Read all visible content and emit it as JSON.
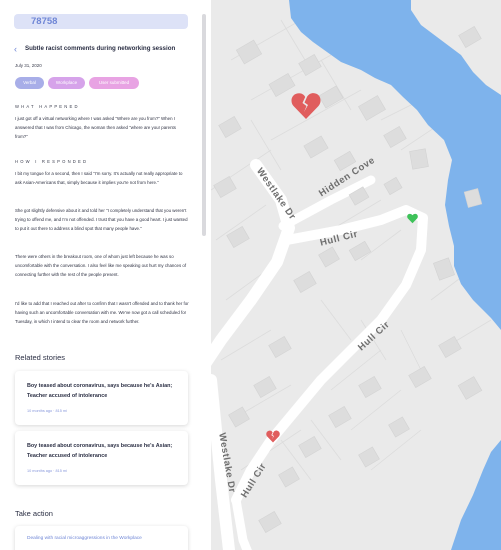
{
  "search": {
    "value": "78758"
  },
  "story": {
    "back_icon": "chevron-left-icon",
    "title": "Subtle racist comments during networking session",
    "date": "July 31, 2020",
    "tags": [
      "Verbal",
      "Workplace",
      "User submitted"
    ],
    "what_happened_label": "WHAT HAPPENED",
    "what_happened": "I just got off a virtual networking where I was asked \"Where are you from?\" When I answered that I was from Chicago, the woman then asked \"where are your parents from?\"",
    "how_responded_label": "HOW I RESPONDED",
    "responses": [
      "I bit my tongue for a second, then I said \"I'm sorry. It's actually not really appropriate to ask Asian-Americans that, simply because it implies you're not from here.\"",
      "She got slightly defensive about it and told her \"I completely understand that you weren't trying to offend me, and I'm not offended. I trust that you have a good heart. I just wanted to put it out there to address a blind spot that many people have.\"",
      "There were others in the breakout room, one of whom just left because he was so uncomfortable with the conversation. I also feel like me speaking out hurt my chances of connecting further with the rest of the people present.",
      "I'd like to add that I reached out after to confirm that I wasn't offended and to thank her for having such an uncomfortable conversation with me. We've now got a call scheduled for Tuesday, in which I intend to clear the room and network further."
    ]
  },
  "related": {
    "heading": "Related stories",
    "items": [
      {
        "title": "Boy teased about coronavirus, says because he's Asian; Teacher accused of intolerance",
        "meta": "10 months ago · 815 mi"
      },
      {
        "title": "Boy teased about coronavirus, says because he's Asian; Teacher accused of intolerance",
        "meta": "10 months ago · 815 mi"
      }
    ]
  },
  "take_action": {
    "heading": "Take action",
    "link": "Dealing with racial microaggressions in the Workplace"
  },
  "map": {
    "colors": {
      "land": "#eaeaea",
      "water": "#7eb3ec",
      "road": "#ffffff",
      "building": "#dddddd",
      "marker_red": "#e05d5d",
      "marker_green": "#3ec25a"
    },
    "road_labels": [
      "Westlake Dr",
      "Hidden Cove",
      "Hull Cir",
      "Hull Cir",
      "Westlake Dr",
      "Hull Cir"
    ],
    "markers": [
      {
        "type": "broken-heart-icon",
        "color": "#e05d5d"
      },
      {
        "type": "heart-icon",
        "color": "#3ec25a"
      },
      {
        "type": "broken-heart-icon",
        "color": "#e05d5d"
      }
    ]
  }
}
